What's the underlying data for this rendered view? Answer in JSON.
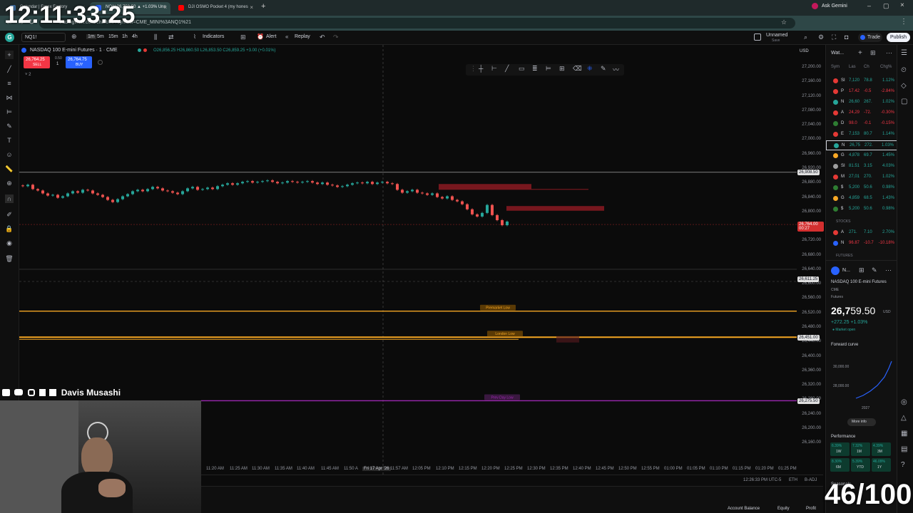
{
  "browser": {
    "tabs": [
      {
        "label": "Calendar | Forex Factory",
        "active": false,
        "fav": "#3b6ea5"
      },
      {
        "label": "NQ1! 26,759.50 ▲ +1.03% Unn",
        "active": true,
        "fav": "#2962ff"
      },
      {
        "label": "DJI OSMO Pocket 4 (my hones",
        "active": false,
        "fav": "#ff0000"
      }
    ],
    "new_tab": "+",
    "ask": "Ask Gemini",
    "url": "tradingview.com/chart/.../?symbol=CME_MINI%3ANQ1%21",
    "clock": "12:11:33:25"
  },
  "toolbar": {
    "symbol": "NQ1!",
    "intervals": [
      "1m",
      "5m",
      "15m",
      "1h",
      "4h"
    ],
    "indicators": "Indicators",
    "alert": "Alert",
    "replay": "Replay",
    "layout_name": "Unnamed",
    "layout_sub": "Save",
    "trade": "Trade",
    "publish": "Publish"
  },
  "legend": {
    "title": "NASDAQ 100 E-mini Futures · 1 · CME",
    "ohlc": "O26,856.25 H26,860.50 L26,853.50 C26,859.25 +3.00 (+0.01%)",
    "sell_price": "26,764.25",
    "sell": "SELL",
    "spread": "0.50",
    "qty": "1",
    "buy_price": "26,764.75",
    "buy": "BUY",
    "study_count": "2"
  },
  "chart_data": {
    "type": "candlestick",
    "currency": "USD",
    "y_ticks": [
      27200,
      27160,
      27120,
      27080,
      27040,
      27000,
      26960,
      26920,
      26880,
      26840,
      26800,
      26760,
      26720,
      26680,
      26640,
      26600,
      26560,
      26520,
      26480,
      26440,
      26400,
      26360,
      26320,
      26280,
      26240,
      26200,
      26160
    ],
    "y_ticks_labels": [
      "27,200.00",
      "27,160.00",
      "27,120.00",
      "27,080.00",
      "27,040.00",
      "27,000.00",
      "26,960.00",
      "26,920.00",
      "26,880.00",
      "26,840.00",
      "26,800.00",
      "26,760.00",
      "26,720.00",
      "26,680.00",
      "26,640.00",
      "26,600.00",
      "26,560.00",
      "26,520.00",
      "26,480.00",
      "26,440.00",
      "26,400.00",
      "26,360.00",
      "26,320.00",
      "26,280.00",
      "26,240.00",
      "26,200.00",
      "26,160.00"
    ],
    "ylim": [
      26140,
      27220
    ],
    "x_ticks": [
      "11:20 AM",
      "11:25 AM",
      "11:30 AM",
      "11:35 AM",
      "11:40 AM",
      "11:45 AM",
      "11:50 A",
      "Fri 17 Apr '26",
      "11:57 AM",
      "12:05 PM",
      "12:10 PM",
      "12:15 PM",
      "12:20 PM",
      "12:25 PM",
      "12:30 PM",
      "12:35 PM",
      "12:40 PM",
      "12:45 PM",
      "12:50 PM",
      "12:55 PM",
      "01:00 PM",
      "01:05 PM",
      "01:10 PM",
      "01:15 PM",
      "01:20 PM",
      "01:25 PM"
    ],
    "price_markers": [
      {
        "price": 26908.5,
        "label": "26,908.50",
        "color": "#ffffff"
      },
      {
        "price": 26764.0,
        "label": "26,764.00",
        "sub": "00:27",
        "color": "#d32f2f"
      },
      {
        "price": 26611.25,
        "label": "26,611.25",
        "color": "#ffffff"
      },
      {
        "price": 26451.0,
        "label": "26,451.00",
        "color": "#ffffff"
      },
      {
        "price": 26275.5,
        "label": "26,275.50",
        "color": "#ffffff"
      }
    ],
    "levels": [
      {
        "name": "Premarket Low",
        "price": 26524,
        "color": "#f5a623"
      },
      {
        "name": "London Low",
        "price": 26452,
        "color": "#f5a623"
      },
      {
        "name": "Prev Day Low",
        "price": 26276,
        "color": "#9c27b0"
      }
    ],
    "candles": [
      26870,
      26874,
      26862,
      26858,
      26850,
      26844,
      26846,
      26838,
      26842,
      26850,
      26856,
      26852,
      26860,
      26858,
      26850,
      26846,
      26840,
      26832,
      26826,
      26834,
      26842,
      26848,
      26856,
      26860,
      26856,
      26862,
      26868,
      26864,
      26858,
      26856,
      26852,
      26848,
      26856,
      26864,
      26868,
      26860,
      26862,
      26866,
      26862,
      26870,
      26874,
      26878,
      26874,
      26878,
      26882,
      26884,
      26880,
      26882,
      26884,
      26886,
      26882,
      26878,
      26880,
      26884,
      26882,
      26880,
      26882,
      26884,
      26880,
      26876,
      26880,
      26874,
      26872,
      26868,
      26870,
      26874,
      26878,
      26880,
      26878,
      26882,
      26876,
      26880,
      26882,
      26878,
      26876,
      26860,
      26852,
      26856,
      26860,
      26852,
      26850,
      26846,
      26850,
      26840,
      26836,
      26842,
      26832,
      26828,
      26820,
      26806,
      26792,
      26786,
      26796,
      26818,
      26790,
      26776,
      26762,
      26772
    ],
    "candle_open": 26872,
    "order_blocks": [
      {
        "top": 26876,
        "bottom": 26870
      },
      {
        "top": 26815,
        "bottom": 26808
      }
    ],
    "timezone": "12:26:33 PM UTC-5",
    "session": "ETH",
    "adj": "B-ADJ"
  },
  "watchlist": {
    "title": "Wat...",
    "cols": [
      "Sym",
      "Las",
      "Ch",
      "Chg%"
    ],
    "rows": [
      {
        "sym": "SI",
        "last": "7,120",
        "chg": "78.8",
        "pct": "1.12%",
        "color": "#e53935",
        "up": true
      },
      {
        "sym": "P",
        "last": "17.42",
        "chg": "-0.5",
        "pct": "-2.84%",
        "color": "#e53935",
        "up": false
      },
      {
        "sym": "N",
        "last": "26,60",
        "chg": "267.",
        "pct": "1.02%",
        "color": "#26a69a",
        "up": true
      },
      {
        "sym": "A",
        "last": "24,29",
        "chg": "-72.",
        "pct": "-0.30%",
        "color": "#e53935",
        "up": false
      },
      {
        "sym": "D",
        "last": "98.0",
        "chg": "-0.1",
        "pct": "-0.15%",
        "color": "#2e7d32",
        "up": false
      },
      {
        "sym": "E",
        "last": "7,153",
        "chg": "80.7",
        "pct": "1.14%",
        "color": "#e53935",
        "up": true
      },
      {
        "sym": "N",
        "last": "26,75",
        "chg": "272.",
        "pct": "1.03%",
        "color": "#26a69a",
        "up": true
      },
      {
        "sym": "G",
        "last": "4,878",
        "chg": "69.7",
        "pct": "1.45%",
        "color": "#f9a825",
        "up": true
      },
      {
        "sym": "SI",
        "last": "81.51",
        "chg": "3.15",
        "pct": "4.03%",
        "color": "#9e9e9e",
        "up": true
      },
      {
        "sym": "M",
        "last": "27,01",
        "chg": "270.",
        "pct": "1.02%",
        "color": "#e53935",
        "up": true
      },
      {
        "sym": "$",
        "last": "5,200",
        "chg": "50.6",
        "pct": "0.98%",
        "color": "#2e7d32",
        "up": true
      },
      {
        "sym": "G",
        "last": "4,859",
        "chg": "68.5",
        "pct": "1.43%",
        "color": "#f9a825",
        "up": true
      },
      {
        "sym": "$",
        "last": "5,200",
        "chg": "50.6",
        "pct": "0.98%",
        "color": "#2e7d32",
        "up": true
      }
    ],
    "section_stocks": "STOCKS",
    "stocks": [
      {
        "sym": "A",
        "last": "271.",
        "chg": "7.10",
        "pct": "2.70%",
        "color": "#e53935",
        "up": true
      },
      {
        "sym": "N",
        "last": "96.87",
        "chg": "-10.7",
        "pct": "-10.18%",
        "color": "#2962ff",
        "up": false
      }
    ],
    "section_futures": "FUTURES"
  },
  "details": {
    "sym": "N...",
    "name": "NASDAQ 100 E-mini Futures",
    "exchange": "CME",
    "kind": "Futures",
    "price_main": "26,7",
    "price_tail": "59.50",
    "currency": "USD",
    "change": "+272.25 +1.03%",
    "status": "Market open",
    "forward_curve": "Forward curve",
    "fc_y1": "30,000.00",
    "fc_y2": "28,000.00",
    "fc_x": "2027",
    "more_info": "More info",
    "performance": "Performance",
    "perf": [
      {
        "v": "6.39%",
        "p": "1W"
      },
      {
        "v": "7.32%",
        "p": "1M"
      },
      {
        "v": "4.39%",
        "p": "3M"
      },
      {
        "v": "8.30%",
        "p": "6M"
      },
      {
        "v": "5.39%",
        "p": "YTD"
      },
      {
        "v": "46.09%",
        "p": "1Y"
      }
    ],
    "seasonals": "Seasonals"
  },
  "bottom": {
    "account_balance": "Account Balance",
    "equity": "Equity",
    "profit": "Profit"
  },
  "stream": {
    "name": "Davis Musashi",
    "counter": "46/100"
  }
}
